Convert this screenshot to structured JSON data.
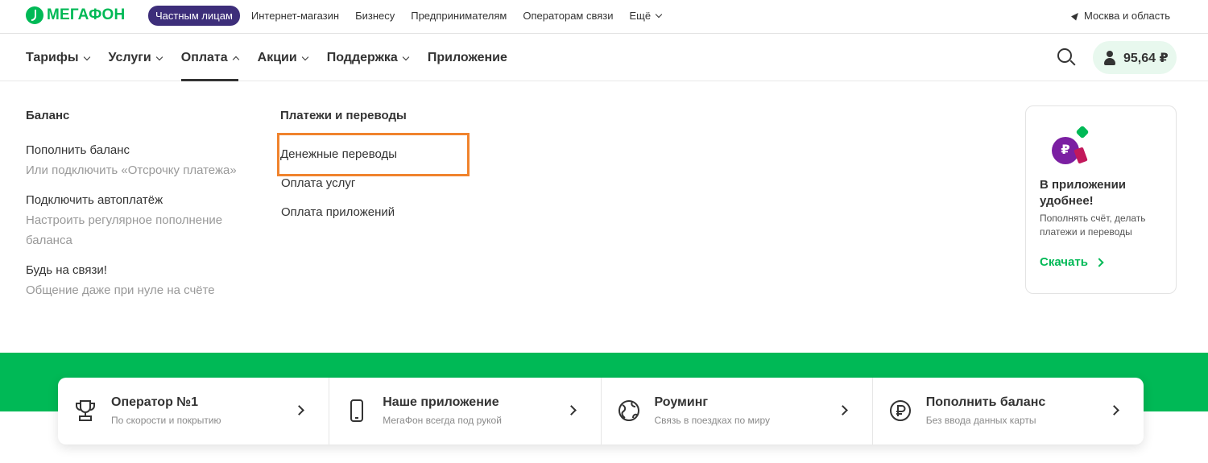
{
  "topbar": {
    "logo": "МЕГАФОН",
    "active_segment": "Частным лицам",
    "links": [
      "Интернет-магазин",
      "Бизнесу",
      "Предпринимателям",
      "Операторам связи"
    ],
    "more": "Ещё",
    "region": "Москва и область"
  },
  "nav": {
    "items": [
      {
        "label": "Тарифы"
      },
      {
        "label": "Услуги"
      },
      {
        "label": "Оплата"
      },
      {
        "label": "Акции"
      },
      {
        "label": "Поддержка"
      },
      {
        "label": "Приложение"
      }
    ],
    "balance": "95,64 ₽"
  },
  "dropdown": {
    "balance_col": {
      "title": "Баланс",
      "groups": [
        {
          "title": "Пополнить баланс",
          "sub": "Или подключить «Отсрочку платежа»"
        },
        {
          "title": "Подключить автоплатёж",
          "sub": "Настроить регулярное пополнение баланса"
        },
        {
          "title": "Будь на связи!",
          "sub": "Общение даже при нуле на счёте"
        }
      ]
    },
    "payments_col": {
      "title": "Платежи и переводы",
      "items": [
        "Денежные переводы",
        "Оплата услуг",
        "Оплата приложений"
      ]
    },
    "app_card": {
      "title": "В приложении удобнее!",
      "text": "Пополнять счёт, делать платежи и переводы",
      "link": "Скачать"
    }
  },
  "quick_links": [
    {
      "title": "Оператор №1",
      "sub": "По скорости и покрытию",
      "icon": "trophy-icon"
    },
    {
      "title": "Наше приложение",
      "sub": "МегаФон всегда под рукой",
      "icon": "phone-icon"
    },
    {
      "title": "Роуминг",
      "sub": "Связь в поездках по миру",
      "icon": "globe-icon"
    },
    {
      "title": "Пополнить баланс",
      "sub": "Без ввода данных карты",
      "icon": "ruble-icon"
    }
  ],
  "colors": {
    "brand": "#00b956",
    "accent": "#3d2e7a",
    "highlight": "#f0832d"
  }
}
